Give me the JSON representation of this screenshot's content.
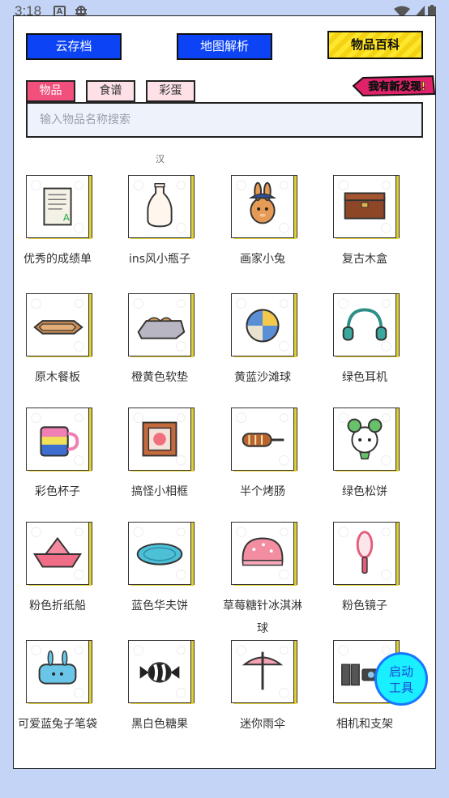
{
  "status": {
    "time": "3:18"
  },
  "toolbar": {
    "cloud_save": "云存档",
    "map_parse": "地图解析",
    "item_wiki": "物品百科"
  },
  "tabs": [
    "物品",
    "食谱",
    "彩蛋"
  ],
  "discover_badge": "我有新发现!",
  "search": {
    "placeholder": "输入物品名称搜索"
  },
  "clipped_text": "汉",
  "items": [
    {
      "label": "优秀的成绩单",
      "icon": "report-card-icon"
    },
    {
      "label": "ins风小瓶子",
      "icon": "vase-icon"
    },
    {
      "label": "画家小兔",
      "icon": "painter-bunny-icon"
    },
    {
      "label": "复古木盒",
      "icon": "wooden-box-icon"
    },
    {
      "label": "原木餐板",
      "icon": "wood-tray-icon"
    },
    {
      "label": "橙黄色软垫",
      "icon": "cushion-icon"
    },
    {
      "label": "黄蓝沙滩球",
      "icon": "beach-ball-icon"
    },
    {
      "label": "绿色耳机",
      "icon": "headphones-icon"
    },
    {
      "label": "彩色杯子",
      "icon": "mug-icon"
    },
    {
      "label": "搞怪小相框",
      "icon": "photo-frame-icon"
    },
    {
      "label": "半个烤肠",
      "icon": "sausage-icon"
    },
    {
      "label": "绿色松饼",
      "icon": "green-muffin-icon"
    },
    {
      "label": "粉色折纸船",
      "icon": "paper-boat-icon"
    },
    {
      "label": "蓝色华夫饼",
      "icon": "blue-waffle-icon"
    },
    {
      "label": "草莓糖针冰淇淋球",
      "icon": "ice-cream-icon"
    },
    {
      "label": "粉色镜子",
      "icon": "mirror-icon"
    },
    {
      "label": "可爱蓝兔子笔袋",
      "icon": "pencil-case-icon"
    },
    {
      "label": "黑白色糖果",
      "icon": "candy-icon"
    },
    {
      "label": "迷你雨伞",
      "icon": "umbrella-icon"
    },
    {
      "label": "相机和支架",
      "icon": "camera-tripod-icon"
    }
  ],
  "fab": {
    "line1": "启动",
    "line2": "工具"
  }
}
